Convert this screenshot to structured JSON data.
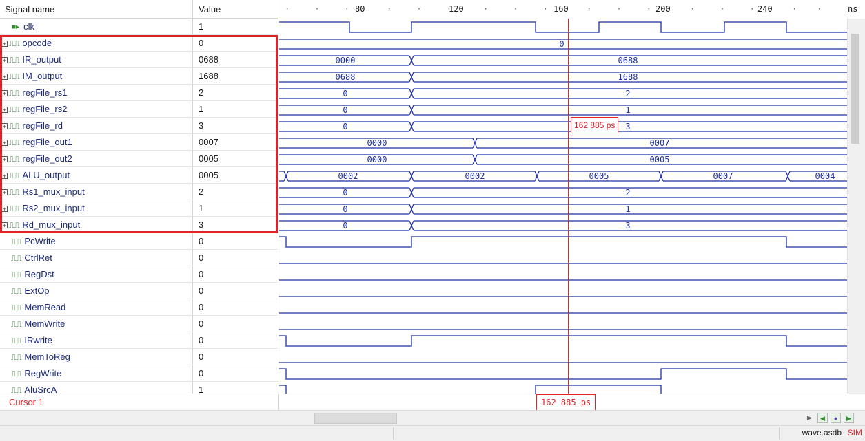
{
  "header": {
    "signal_col": "Signal name",
    "value_col": "Value",
    "time_unit": "ns",
    "ticks": [
      "80",
      "120",
      "160",
      "200",
      "240"
    ]
  },
  "signals": [
    {
      "name": "clk",
      "value": "1",
      "kind": "clock"
    },
    {
      "name": "opcode",
      "value": "0",
      "kind": "bus"
    },
    {
      "name": "IR_output",
      "value": "0688",
      "kind": "bus"
    },
    {
      "name": "IM_output",
      "value": "1688",
      "kind": "bus"
    },
    {
      "name": "regFile_rs1",
      "value": "2",
      "kind": "bus"
    },
    {
      "name": "regFile_rs2",
      "value": "1",
      "kind": "bus"
    },
    {
      "name": "regFile_rd",
      "value": "3",
      "kind": "bus"
    },
    {
      "name": "regFile_out1",
      "value": "0007",
      "kind": "bus"
    },
    {
      "name": "regFile_out2",
      "value": "0005",
      "kind": "bus"
    },
    {
      "name": "ALU_output",
      "value": "0005",
      "kind": "bus"
    },
    {
      "name": "Rs1_mux_input",
      "value": "2",
      "kind": "bus"
    },
    {
      "name": "Rs2_mux_input",
      "value": "1",
      "kind": "bus"
    },
    {
      "name": "Rd_mux_input",
      "value": "3",
      "kind": "bus"
    },
    {
      "name": "PcWrite",
      "value": "0",
      "kind": "bit"
    },
    {
      "name": "CtrlRet",
      "value": "0",
      "kind": "bit"
    },
    {
      "name": "RegDst",
      "value": "0",
      "kind": "bit"
    },
    {
      "name": "ExtOp",
      "value": "0",
      "kind": "bit"
    },
    {
      "name": "MemRead",
      "value": "0",
      "kind": "bit"
    },
    {
      "name": "MemWrite",
      "value": "0",
      "kind": "bit"
    },
    {
      "name": "IRwrite",
      "value": "0",
      "kind": "bit"
    },
    {
      "name": "MemToReg",
      "value": "0",
      "kind": "bit"
    },
    {
      "name": "RegWrite",
      "value": "0",
      "kind": "bit"
    },
    {
      "name": "AluSrcA",
      "value": "1",
      "kind": "bit"
    }
  ],
  "bus_labels": {
    "opcode": [
      "0"
    ],
    "IR_output": [
      "0000",
      "0688"
    ],
    "IM_output": [
      "0688",
      "1688"
    ],
    "regFile_rs1": [
      "0",
      "2"
    ],
    "regFile_rs2": [
      "0",
      "1"
    ],
    "regFile_rd": [
      "0",
      "3"
    ],
    "regFile_out1": [
      "0000",
      "0007"
    ],
    "regFile_out2": [
      "0000",
      "0005"
    ],
    "ALU_output": [
      "0002",
      "0002",
      "0005",
      "0007",
      "0004"
    ],
    "Rs1_mux_input": [
      "0",
      "2"
    ],
    "Rs2_mux_input": [
      "0",
      "1"
    ],
    "Rd_mux_input": [
      "0",
      "3"
    ]
  },
  "cursor": {
    "name": "Cursor 1",
    "time": "162 885 ps",
    "tooltip": "162 885 ps"
  },
  "status": {
    "file": "wave.asdb",
    "mode": "SIM"
  },
  "colors": {
    "wave": "#1f2fa0",
    "cursor": "#e0242a",
    "signal_icon": "#1f7a1f",
    "signal_name": "#1d2b7a"
  }
}
